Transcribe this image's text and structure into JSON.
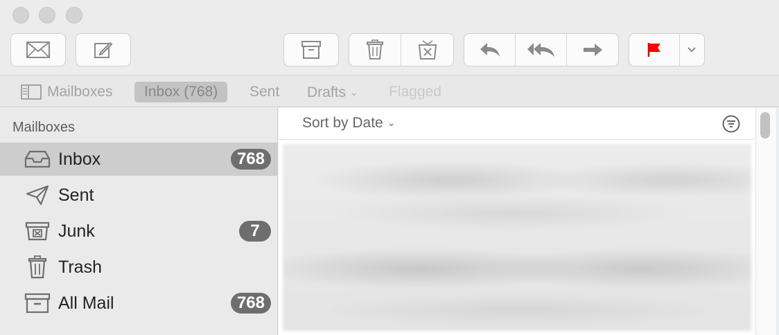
{
  "toolbar": {
    "buttons": [
      "get-mail",
      "compose",
      "archive",
      "delete",
      "junk",
      "reply",
      "reply-all",
      "forward",
      "flag",
      "flag-menu"
    ],
    "flag_color": "#ff0000"
  },
  "favorites": {
    "mailboxes_label": "Mailboxes",
    "inbox_label": "Inbox (768)",
    "sent_label": "Sent",
    "drafts_label": "Drafts",
    "flagged_label": "Flagged"
  },
  "sidebar": {
    "heading": "Mailboxes",
    "items": [
      {
        "label": "Inbox",
        "badge": "768",
        "icon": "inbox-tray-icon"
      },
      {
        "label": "Sent",
        "icon": "paper-plane-icon"
      },
      {
        "label": "Junk",
        "badge": "7",
        "icon": "junk-bin-icon"
      },
      {
        "label": "Trash",
        "icon": "trash-can-icon"
      },
      {
        "label": "All Mail",
        "badge": "768",
        "icon": "archive-box-icon"
      }
    ]
  },
  "message_list": {
    "sort_label": "Sort by Date"
  },
  "colors": {
    "accent_flag": "#ff0000",
    "badge_bg": "#6e6e6e",
    "selection": "#cdcdcd"
  }
}
